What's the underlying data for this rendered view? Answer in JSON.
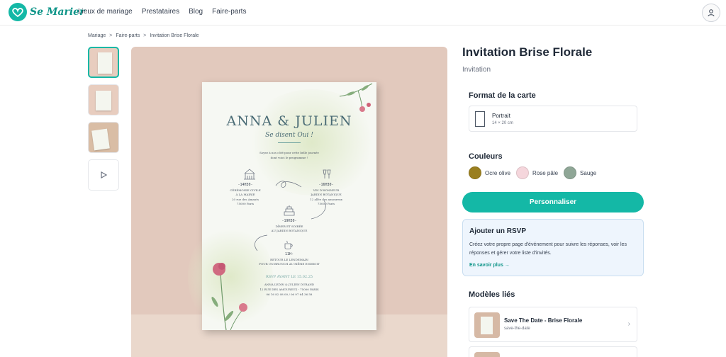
{
  "brand": {
    "name": "Se Marier",
    "accent": "#14b8a6"
  },
  "nav": {
    "items": [
      "Lieux de mariage",
      "Prestataires",
      "Blog",
      "Faire-parts"
    ]
  },
  "breadcrumb": [
    "Mariage",
    "Faire-parts",
    "Invitation Brise Florale"
  ],
  "product": {
    "title": "Invitation Brise Florale",
    "category": "Invitation"
  },
  "invitation": {
    "names": "ANNA & JULIEN",
    "subtitle": "Se disent Oui !",
    "intro1": "Soyez à nos côté pour cette belle journée",
    "intro2": "dont voici le programme !",
    "e1_time": "-14H30-",
    "e1_line1": "CÉRÉMONIE CIVILE",
    "e1_line2": "À LA MAIRIE",
    "e1_line3": "20 rue des Amants",
    "e1_line4": "75000 Paris",
    "e2_time": "-16H30-",
    "e2_line1": "VIN D'HONNEUR",
    "e2_line2": "JARDIN BOTANIQUE",
    "e2_line3": "12 allée des amoureux",
    "e2_line4": "75000 Paris",
    "e3_time": "-19H30-",
    "e3_line1": "DÎNER ET SOIRÉE",
    "e3_line2": "AU JARDIN BOTANIQUE",
    "e4_time": "11H-",
    "e4_line1": "RETOUR LE LENDEMAIN",
    "e4_line2": "POUR UN BRUNCH AU MÊME ENDROIT",
    "rsvp": "RSVP AVANT LE 15.02.25",
    "contact1": "ANNA LEDIN & JULIEN DURAND",
    "contact2": "12 RUE DES AMOUREUX - 75000 PARIS",
    "contact3": "06 16 82 08 00 / 06 97 64 36 58"
  },
  "format": {
    "heading": "Format de la carte",
    "label": "Portrait",
    "size": "14 × 20 cm"
  },
  "colors": {
    "heading": "Couleurs",
    "items": [
      {
        "name": "Ocre olive",
        "hex": "#9a7f1f"
      },
      {
        "name": "Rose pâle",
        "hex": "#f5d6dc"
      },
      {
        "name": "Sauge",
        "hex": "#8fa696"
      }
    ]
  },
  "cta": {
    "label": "Personnaliser"
  },
  "rsvp_box": {
    "title": "Ajouter un RSVP",
    "text": "Créez votre propre page d'événement pour suivre les réponses, voir les réponses et gérer votre liste d'invités.",
    "link": "En savoir plus →"
  },
  "related": {
    "heading": "Modèles liés",
    "items": [
      {
        "title": "Save The Date - Brise Florale",
        "slug": "save-the-date"
      }
    ]
  }
}
